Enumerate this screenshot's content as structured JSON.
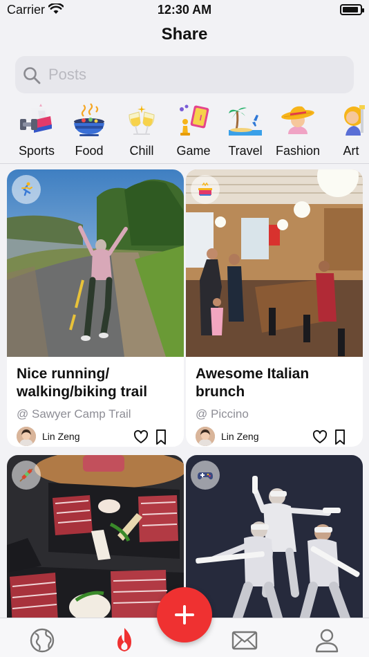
{
  "status_bar": {
    "carrier": "Carrier",
    "time": "12:30 AM",
    "battery_level": 0.9
  },
  "nav": {
    "title": "Share"
  },
  "search": {
    "placeholder": "Posts",
    "value": ""
  },
  "categories": [
    {
      "label": "Sports",
      "icon": "dumbbell-sneaker-icon"
    },
    {
      "label": "Food",
      "icon": "steaming-bowl-icon"
    },
    {
      "label": "Chill",
      "icon": "cheers-glasses-icon"
    },
    {
      "label": "Game",
      "icon": "chess-game-icon"
    },
    {
      "label": "Travel",
      "icon": "beach-plane-icon"
    },
    {
      "label": "Fashion",
      "icon": "sun-hat-woman-icon"
    },
    {
      "label": "Art",
      "icon": "artist-palette-icon"
    }
  ],
  "posts": [
    {
      "title": "Nice running/ walking/biking trail",
      "place": "@ Sawyer Camp Trail",
      "author": "Lin Zeng",
      "category_icon": "runner-icon"
    },
    {
      "title": "Awesome Italian brunch",
      "place": "@ Piccino",
      "author": "Lin Zeng",
      "category_icon": "restaurant-icon"
    },
    {
      "category_icon": "kebab-skewer-icon"
    },
    {
      "category_icon": "game-controller-icon"
    }
  ],
  "tab_bar": {
    "items": [
      {
        "icon": "globe-icon"
      },
      {
        "icon": "flame-icon",
        "active": true
      },
      {
        "icon": "envelope-icon"
      },
      {
        "icon": "profile-icon"
      }
    ],
    "fab_icon": "plus-icon",
    "accent_color": "#ef3131"
  }
}
